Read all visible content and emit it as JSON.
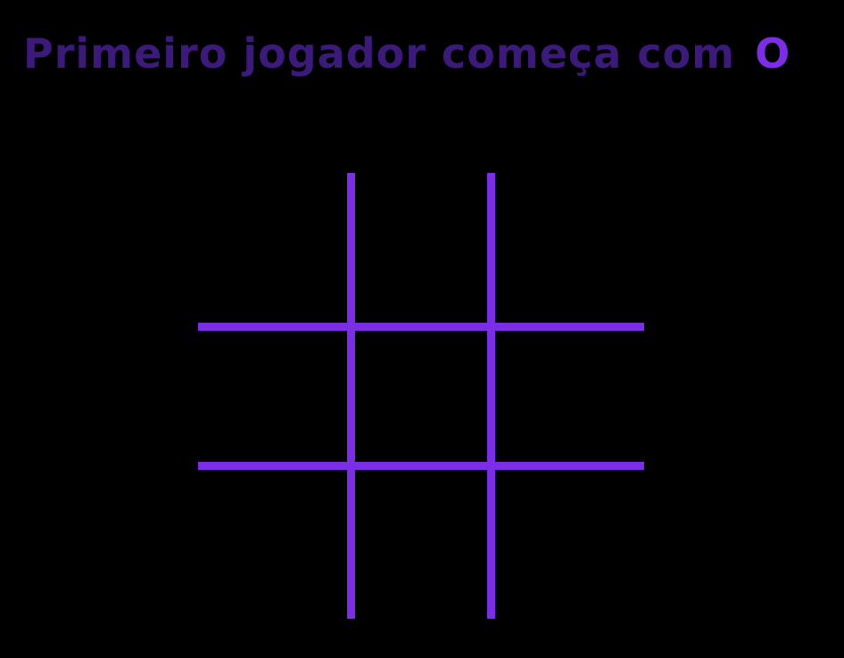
{
  "header": {
    "title": "Primeiro jogador começa com",
    "current_symbol": "O"
  },
  "board": {
    "cells": [
      "",
      "",
      "",
      "",
      "",
      "",
      "",
      "",
      ""
    ]
  },
  "colors": {
    "background": "#000000",
    "title": "#3b1a7a",
    "accent": "#7b2ee6"
  }
}
